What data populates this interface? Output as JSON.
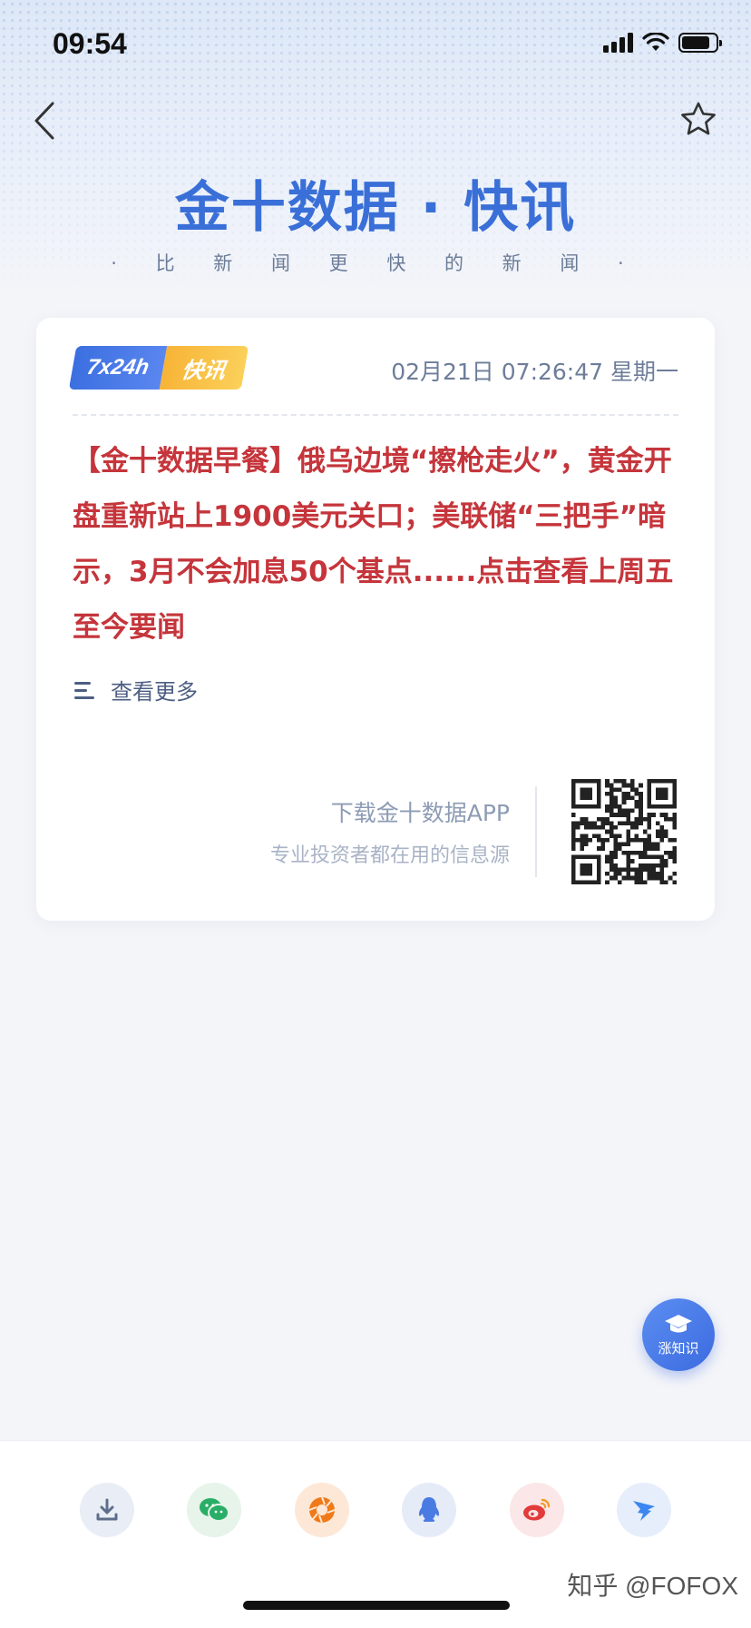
{
  "status_bar": {
    "time": "09:54",
    "battery_level": 0.85
  },
  "header": {
    "back_icon": "chevron-left-icon",
    "favorite_icon": "star-outline-icon",
    "brand_title": "金十数据 · 快讯",
    "brand_subtitle": "· 比 新 闻 更 快 的 新 闻 ·",
    "accent_color": "#3a6fd8"
  },
  "card": {
    "badge_left": "7x24h",
    "badge_right": "快讯",
    "timestamp": "02月21日 07:26:47 星期一",
    "headline": "【金十数据早餐】俄乌边境“擦枪走火”，黄金开盘重新站上1900美元关口；美联储“三把手”暗示，3月不会加息50个基点......点击查看上周五至今要闻",
    "headline_color": "#c5353b",
    "more_label": "查看更多",
    "download_title": "下载金十数据APP",
    "download_subtitle": "专业投资者都在用的信息源"
  },
  "fab": {
    "icon": "graduation-cap-icon",
    "label": "涨知识"
  },
  "share_bar": {
    "items": [
      {
        "name": "download",
        "icon": "download-icon",
        "bg": "#e9edf5",
        "color": "#5e6e8c"
      },
      {
        "name": "wechat",
        "icon": "wechat-icon",
        "bg": "#e6f4ea",
        "color": "#2aae67"
      },
      {
        "name": "moments",
        "icon": "aperture-icon",
        "bg": "#fde8d7",
        "color": "#f07a1a"
      },
      {
        "name": "qq",
        "icon": "qq-penguin-icon",
        "bg": "#e6ebf8",
        "color": "#4a7be3"
      },
      {
        "name": "weibo",
        "icon": "weibo-icon",
        "bg": "#fbe7e7",
        "color": "#e23b3b"
      },
      {
        "name": "dingtalk",
        "icon": "dingtalk-icon",
        "bg": "#e6eefb",
        "color": "#3b86f0"
      }
    ],
    "watermark": "知乎 @FOFOX"
  }
}
